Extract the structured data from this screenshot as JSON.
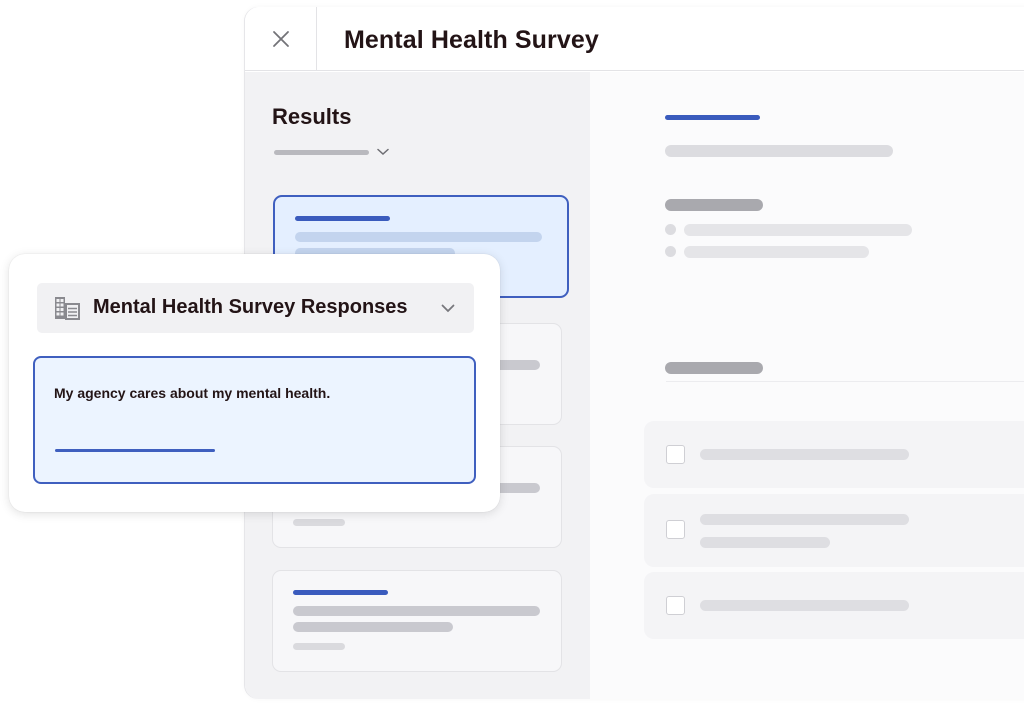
{
  "window": {
    "title": "Mental Health Survey",
    "close_icon": "close-icon"
  },
  "sidebar": {
    "title": "Results",
    "filter_icon": "chevron-down-icon",
    "cards": [
      {
        "state": "selected"
      },
      {
        "state": "default"
      },
      {
        "state": "default"
      },
      {
        "state": "default"
      }
    ]
  },
  "detail": {
    "options": [
      {
        "checked": false
      },
      {
        "checked": false
      },
      {
        "checked": false
      }
    ]
  },
  "popup": {
    "dataset_icon": "table-icon",
    "dataset_label": "Mental Health Survey Responses",
    "dataset_chevron_icon": "chevron-down-icon",
    "question": "My agency cares about my mental health."
  },
  "colors": {
    "accent": "#3f5fbf",
    "selected_bg": "#e4efff",
    "question_bg": "#ecf4ff",
    "text": "#231416",
    "sidebar_bg": "#f2f2f4"
  }
}
